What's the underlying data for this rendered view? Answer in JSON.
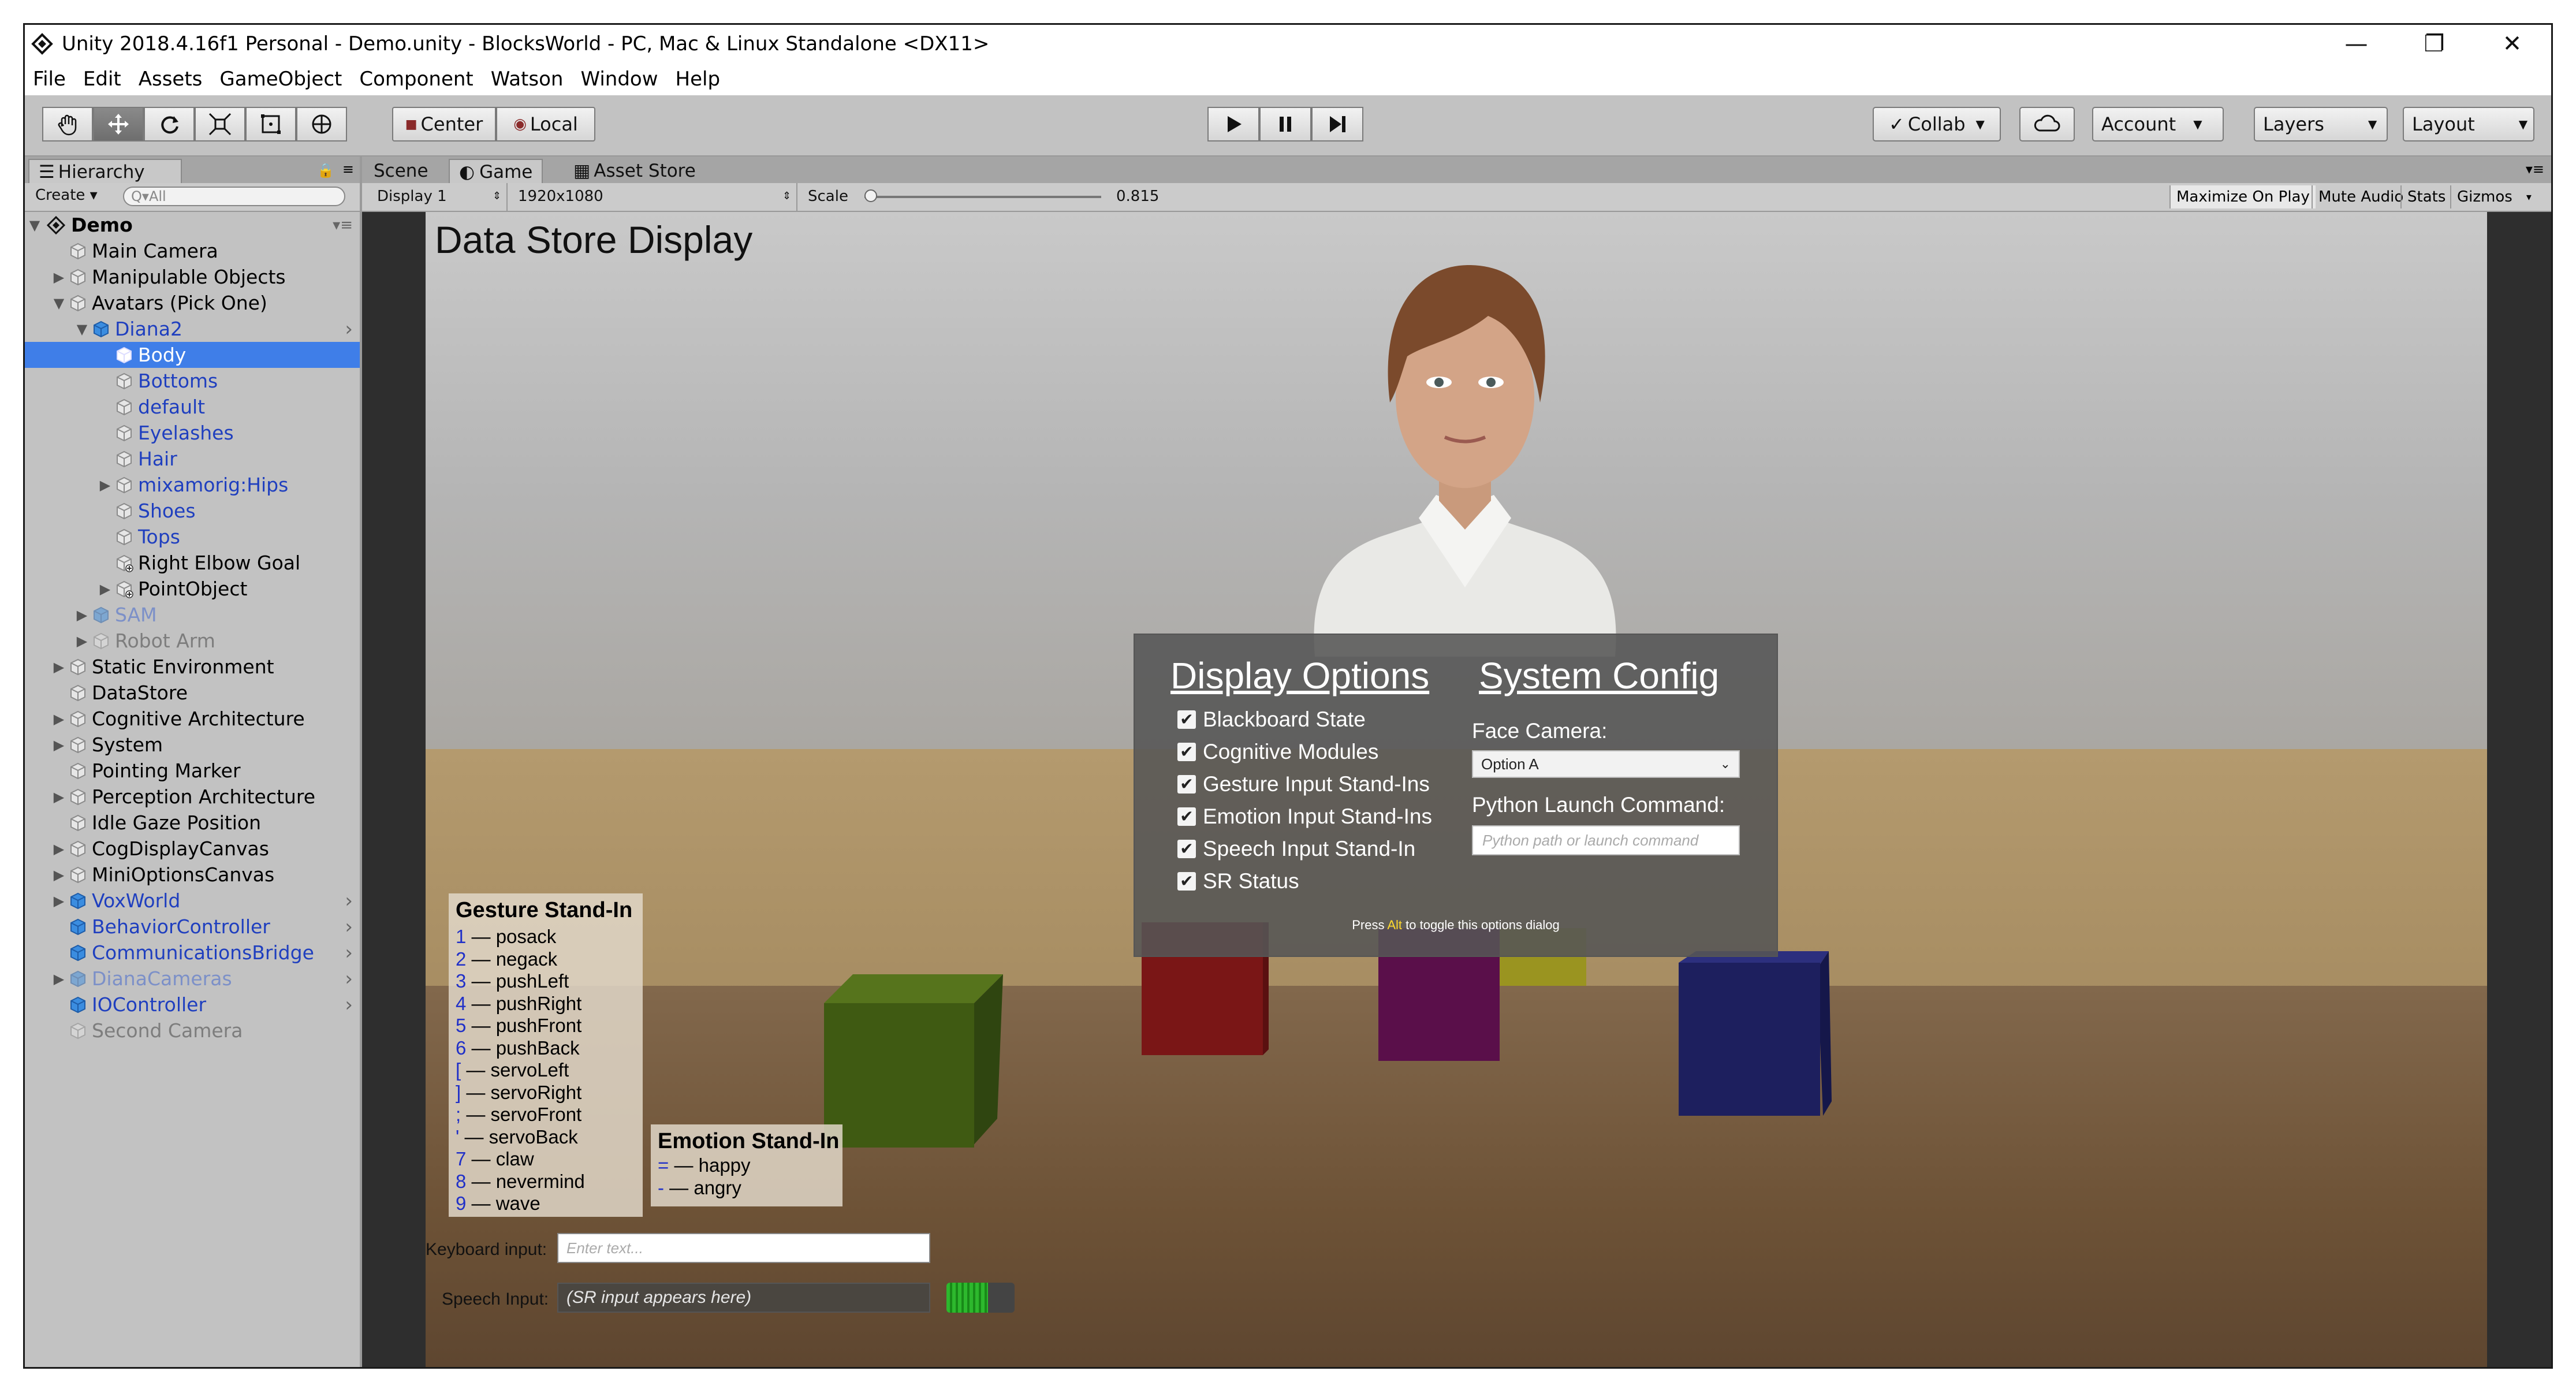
{
  "window": {
    "title": "Unity 2018.4.16f1 Personal - Demo.unity - BlocksWorld - PC, Mac & Linux Standalone <DX11>",
    "controls": {
      "minimize": "—",
      "restore": "❐",
      "close": "✕"
    }
  },
  "menu": [
    "File",
    "Edit",
    "Assets",
    "GameObject",
    "Component",
    "Watson",
    "Window",
    "Help"
  ],
  "toolbar": {
    "tools": [
      "hand-tool-icon",
      "move-tool-icon",
      "rotate-tool-icon",
      "scale-tool-icon",
      "rect-tool-icon",
      "transform-tool-icon"
    ],
    "pivot": "Center",
    "space": "Local",
    "collab": "Collab",
    "account": "Account",
    "layers": "Layers",
    "layout": "Layout"
  },
  "hierarchy": {
    "tab": "Hierarchy",
    "create": "Create",
    "search_placeholder": "Q▾All",
    "scene": "Demo",
    "items": [
      {
        "label": "Main Camera",
        "depth": 1,
        "arrow": "",
        "icon": "gameobject",
        "style": "normal"
      },
      {
        "label": "Manipulable Objects",
        "depth": 1,
        "arrow": "▶",
        "icon": "gameobject",
        "style": "normal"
      },
      {
        "label": "Avatars (Pick One)",
        "depth": 1,
        "arrow": "▼",
        "icon": "gameobject",
        "style": "normal"
      },
      {
        "label": "Diana2",
        "depth": 2,
        "arrow": "▼",
        "icon": "prefab",
        "style": "prefab",
        "chev": true
      },
      {
        "label": "Body",
        "depth": 3,
        "arrow": "",
        "icon": "gameobject",
        "style": "selected"
      },
      {
        "label": "Bottoms",
        "depth": 3,
        "arrow": "",
        "icon": "gameobject",
        "style": "prefab"
      },
      {
        "label": "default",
        "depth": 3,
        "arrow": "",
        "icon": "gameobject",
        "style": "prefab"
      },
      {
        "label": "Eyelashes",
        "depth": 3,
        "arrow": "",
        "icon": "gameobject",
        "style": "prefab"
      },
      {
        "label": "Hair",
        "depth": 3,
        "arrow": "",
        "icon": "gameobject",
        "style": "prefab"
      },
      {
        "label": "mixamorig:Hips",
        "depth": 3,
        "arrow": "▶",
        "icon": "gameobject",
        "style": "prefab"
      },
      {
        "label": "Shoes",
        "depth": 3,
        "arrow": "",
        "icon": "gameobject",
        "style": "prefab"
      },
      {
        "label": "Tops",
        "depth": 3,
        "arrow": "",
        "icon": "gameobject",
        "style": "prefab"
      },
      {
        "label": "Right Elbow Goal",
        "depth": 3,
        "arrow": "",
        "icon": "added",
        "style": "normal"
      },
      {
        "label": "PointObject",
        "depth": 3,
        "arrow": "▶",
        "icon": "added",
        "style": "normal"
      },
      {
        "label": "SAM",
        "depth": 2,
        "arrow": "▶",
        "icon": "prefab",
        "style": "prefab-disabled"
      },
      {
        "label": "Robot Arm",
        "depth": 2,
        "arrow": "▶",
        "icon": "gameobject",
        "style": "disabled"
      },
      {
        "label": "Static Environment",
        "depth": 1,
        "arrow": "▶",
        "icon": "gameobject",
        "style": "normal"
      },
      {
        "label": "DataStore",
        "depth": 1,
        "arrow": "",
        "icon": "gameobject",
        "style": "normal"
      },
      {
        "label": "Cognitive Architecture",
        "depth": 1,
        "arrow": "▶",
        "icon": "gameobject",
        "style": "normal"
      },
      {
        "label": "System",
        "depth": 1,
        "arrow": "▶",
        "icon": "gameobject",
        "style": "normal"
      },
      {
        "label": "Pointing Marker",
        "depth": 1,
        "arrow": "",
        "icon": "gameobject",
        "style": "normal"
      },
      {
        "label": "Perception Architecture",
        "depth": 1,
        "arrow": "▶",
        "icon": "gameobject",
        "style": "normal"
      },
      {
        "label": "Idle Gaze Position",
        "depth": 1,
        "arrow": "",
        "icon": "gameobject",
        "style": "normal"
      },
      {
        "label": "CogDisplayCanvas",
        "depth": 1,
        "arrow": "▶",
        "icon": "gameobject",
        "style": "normal"
      },
      {
        "label": "MiniOptionsCanvas",
        "depth": 1,
        "arrow": "▶",
        "icon": "gameobject",
        "style": "normal"
      },
      {
        "label": "VoxWorld",
        "depth": 1,
        "arrow": "▶",
        "icon": "prefab",
        "style": "prefab",
        "chev": true
      },
      {
        "label": "BehaviorController",
        "depth": 1,
        "arrow": "",
        "icon": "prefab",
        "style": "prefab",
        "chev": true
      },
      {
        "label": "CommunicationsBridge",
        "depth": 1,
        "arrow": "",
        "icon": "prefab",
        "style": "prefab",
        "chev": true
      },
      {
        "label": "DianaCameras",
        "depth": 1,
        "arrow": "▶",
        "icon": "prefab",
        "style": "prefab-disabled",
        "chev": true
      },
      {
        "label": "IOController",
        "depth": 1,
        "arrow": "",
        "icon": "prefab",
        "style": "prefab",
        "chev": true
      },
      {
        "label": "Second Camera",
        "depth": 1,
        "arrow": "",
        "icon": "gameobject",
        "style": "disabled"
      }
    ]
  },
  "game_tabs": {
    "scene": "Scene",
    "game": "Game",
    "asset_store": "Asset Store"
  },
  "game_bar": {
    "display": "Display 1",
    "resolution": "1920x1080",
    "scale_label": "Scale",
    "scale_value": "0.815",
    "scale_fraction": 0.0,
    "maximize": "Maximize On Play",
    "mute": "Mute Audio",
    "stats": "Stats",
    "gizmos": "Gizmos"
  },
  "game": {
    "title": "Data Store Display",
    "options": {
      "display_header": "Display Options",
      "system_header": "System Config",
      "checkboxes": [
        "Blackboard State",
        "Cognitive Modules",
        "Gesture Input Stand-Ins",
        "Emotion Input Stand-Ins",
        "Speech Input Stand-In",
        "SR Status"
      ],
      "face_camera_label": "Face Camera:",
      "face_camera_value": "Option A",
      "python_label": "Python Launch Command:",
      "python_placeholder": "Python path or launch command",
      "hint_prefix": "Press ",
      "hint_key": "Alt",
      "hint_suffix": " to toggle this options dialog"
    },
    "gesture": {
      "title": "Gesture Stand-In",
      "entries": [
        {
          "key": "1",
          "text": " — posack"
        },
        {
          "key": "2",
          "text": " — negack"
        },
        {
          "key": "3",
          "text": " — pushLeft"
        },
        {
          "key": "4",
          "text": " — pushRight"
        },
        {
          "key": "5",
          "text": " — pushFront"
        },
        {
          "key": "6",
          "text": " — pushBack"
        },
        {
          "key": "[",
          "text": " — servoLeft"
        },
        {
          "key": "]",
          "text": " — servoRight"
        },
        {
          "key": ";",
          "text": " — servoFront"
        },
        {
          "key": "'",
          "text": " — servoBack"
        },
        {
          "key": "7",
          "text": " — claw"
        },
        {
          "key": "8",
          "text": " — nevermind"
        },
        {
          "key": "9",
          "text": " — wave"
        }
      ]
    },
    "emotion": {
      "title": "Emotion Stand-In",
      "entries": [
        {
          "key": "=",
          "text": " — happy"
        },
        {
          "key": "-",
          "text": " — angry"
        }
      ]
    },
    "keyboard_label": "Keyboard input:",
    "keyboard_placeholder": "Enter text...",
    "speech_label": "Speech Input:",
    "speech_placeholder": "(SR input appears here)"
  },
  "colors": {
    "selection": "#3f7ee8",
    "prefab_text": "#1f3fbf",
    "disabled_text": "#7d7d7d",
    "cube_green": "#3f5a12",
    "cube_red": "#7a1616",
    "cube_purple": "#5a0f4a",
    "cube_blue": "#1d1f5e",
    "cube_yellow": "#9a9420"
  }
}
